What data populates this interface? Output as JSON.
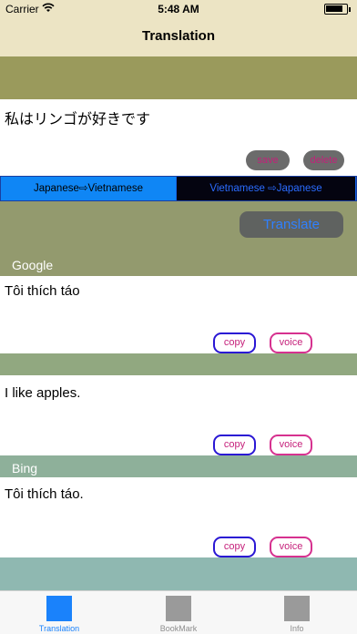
{
  "status_bar": {
    "carrier": "Carrier",
    "time": "5:48 AM"
  },
  "nav": {
    "title": "Translation"
  },
  "input": {
    "text": "私はリンゴが好きです",
    "save_label": "save",
    "delete_label": "delete"
  },
  "direction": {
    "left_label": "Japanese⇨Vietnamese",
    "right_label": "Vietnamese ⇨Japanese"
  },
  "translate_label": "Translate",
  "results": {
    "google_label": "Google",
    "google_vi": "Tôi thích táo",
    "google_en": "I like apples.",
    "bing_label": "Bing",
    "bing_vi": "Tôi thích táo.",
    "copy_label": "copy",
    "voice_label": "voice"
  },
  "tabs": [
    {
      "label": "Translation",
      "color": "#1a82fb"
    },
    {
      "label": "BookMark",
      "color": "#9a9a9a"
    },
    {
      "label": "Info",
      "color": "#9a9a9a"
    }
  ]
}
